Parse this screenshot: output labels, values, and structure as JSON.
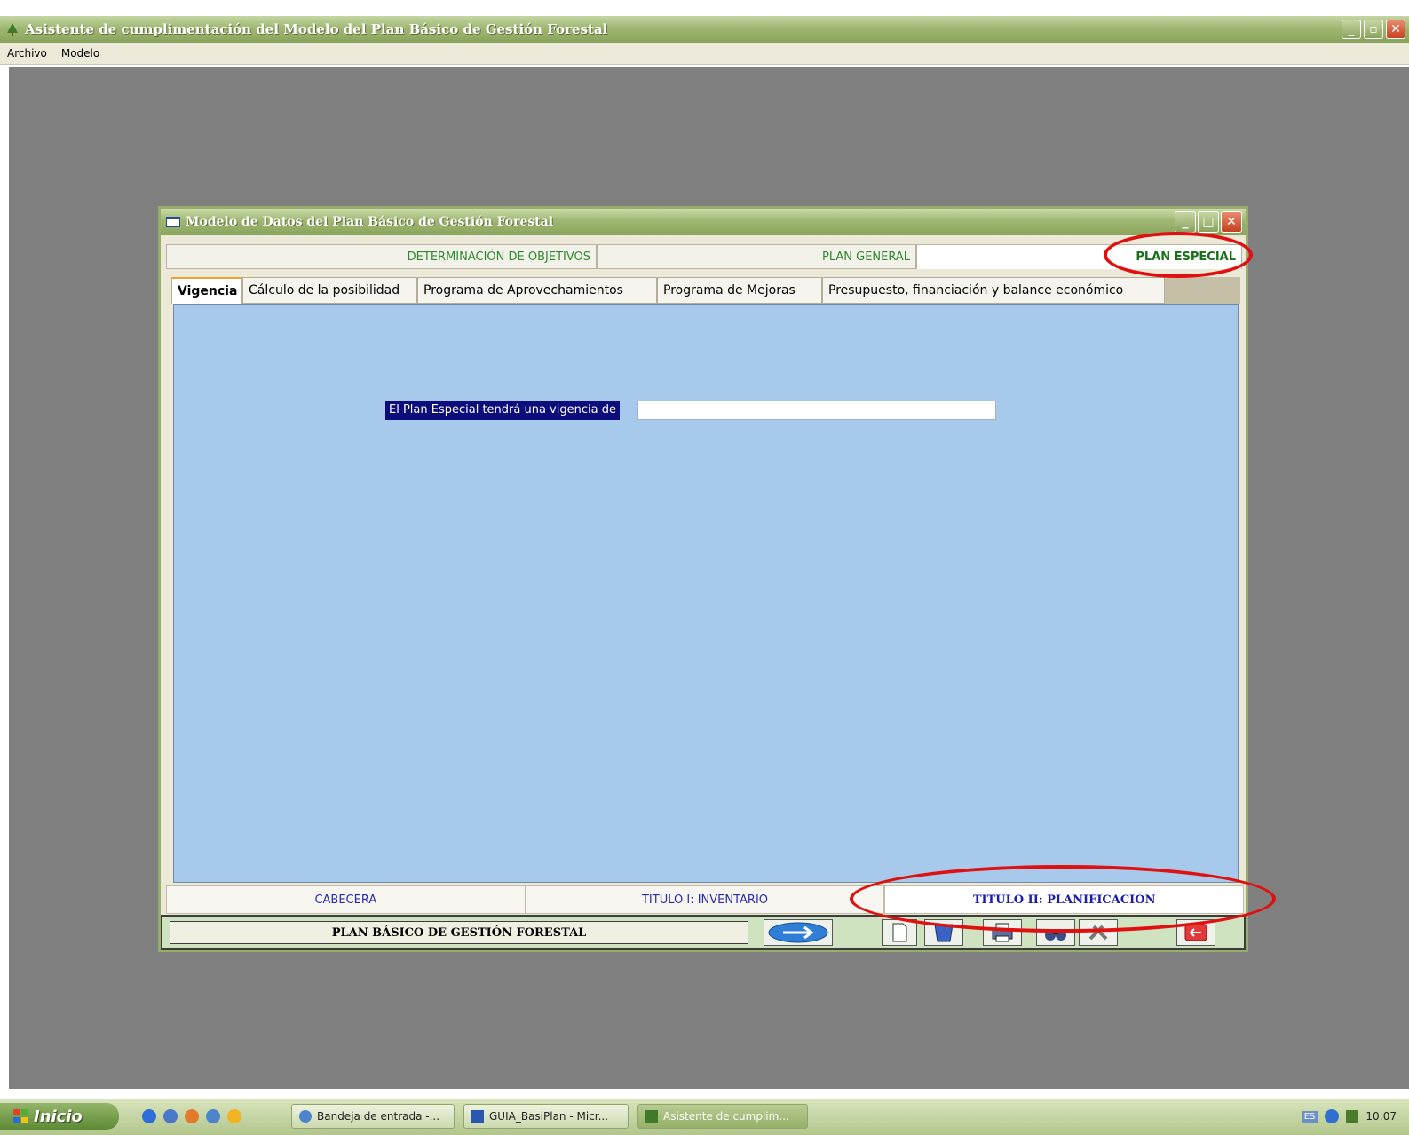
{
  "app": {
    "title": "Asistente de cumplimentación del Modelo del Plan Básico de Gestión Forestal",
    "menu": [
      "Archivo",
      "Modelo"
    ]
  },
  "form": {
    "title": "Modelo de Datos del Plan Básico de Gestión Forestal",
    "top_tabs": [
      {
        "label": "DETERMINACIÓN DE OBJETIVOS"
      },
      {
        "label": "PLAN GENERAL"
      },
      {
        "label": "PLAN ESPECIAL",
        "active": true
      }
    ],
    "sub_tabs": [
      {
        "label": "Vigencia",
        "active": true
      },
      {
        "label": "Cálculo de la posibilidad"
      },
      {
        "label": "Programa de Aprovechamientos"
      },
      {
        "label": "Programa de Mejoras"
      },
      {
        "label": "Presupuesto, financiación y balance económico"
      }
    ],
    "vigencia_label": "El Plan Especial tendrá una vigencia de",
    "vigencia_value": "",
    "bottom_tabs": [
      {
        "label": "CABECERA"
      },
      {
        "label": "TITULO I: INVENTARIO"
      },
      {
        "label": "TITULO II: PLANIFICACIÓN",
        "active": true
      }
    ],
    "toolbar_label": "PLAN BÁSICO DE GESTIÓN FORESTAL"
  },
  "taskbar": {
    "start_label": "Inicio",
    "tasks": [
      {
        "label": "Bandeja de entrada -..."
      },
      {
        "label": "GUIA_BasiPlan - Micr..."
      },
      {
        "label": "Asistente de cumplim...",
        "active": true
      }
    ],
    "lang": "ES",
    "clock": "10:07"
  },
  "colors": {
    "titlebar": "#9fb772",
    "content_bg": "#a7c9ec",
    "label_bg": "#0c0c7a",
    "annotation": "#e01010",
    "tab_green": "#2f8a2f",
    "tab_blue": "#2a2ab4"
  }
}
